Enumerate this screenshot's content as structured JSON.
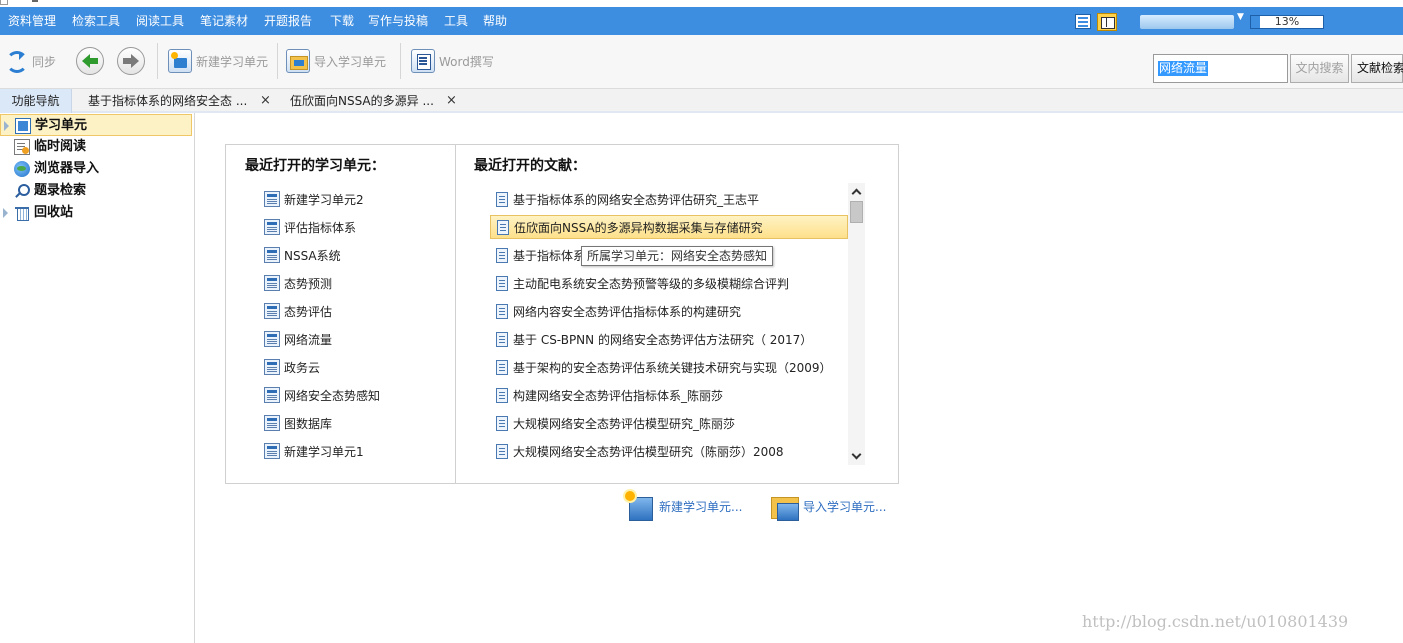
{
  "menu": [
    "资料管理",
    "检索工具",
    "阅读工具",
    "笔记素材",
    "开题报告",
    "下载",
    "写作与投稿",
    "工具",
    "帮助"
  ],
  "progress": {
    "text": "13%",
    "value": 0.13
  },
  "toolbar": {
    "sync": "同步",
    "new_unit": "新建学习单元",
    "import_unit": "导入学习单元",
    "word": "Word撰写"
  },
  "search": {
    "value": "网络流量",
    "fulltext_btn": "文内搜索",
    "doc_btn": "文献检索"
  },
  "tabs": {
    "nav": "功能导航",
    "items": [
      "基于指标体系的网络安全态 ...",
      "伍欣面向NSSA的多源异 ..."
    ],
    "close": "×"
  },
  "sidebar": {
    "items": [
      "学习单元",
      "临时阅读",
      "浏览器导入",
      "题录检索",
      "回收站"
    ]
  },
  "recent_units": {
    "title": "最近打开的学习单元：",
    "items": [
      "新建学习单元2",
      "评估指标体系",
      "NSSA系统",
      "态势预测",
      "态势评估",
      "网络流量",
      "政务云",
      "网络安全态势感知",
      "图数据库",
      "新建学习单元1"
    ]
  },
  "recent_docs": {
    "title": "最近打开的文献：",
    "items": [
      "基于指标体系的网络安全态势评估研究_王志平",
      "伍欣面向NSSA的多源异构数据采集与存储研究",
      "基于指标体系",
      "主动配电系统安全态势预警等级的多级模糊综合评判",
      "网络内容安全态势评估指标体系的构建研究",
      "基于 CS-BPNN 的网络安全态势评估方法研究（ 2017）",
      "基于架构的安全态势评估系统关键技术研究与实现（2009）",
      "构建网络安全态势评估指标体系_陈丽莎",
      "大规模网络安全态势评估模型研究_陈丽莎",
      "大规模网络安全态势评估模型研究（陈丽莎）2008"
    ],
    "tooltip": "所属学习单元：网络安全态势感知"
  },
  "actions": {
    "new_unit": "新建学习单元...",
    "import_unit": "导入学习单元..."
  },
  "watermark": "http://blog.csdn.net/u010801439"
}
